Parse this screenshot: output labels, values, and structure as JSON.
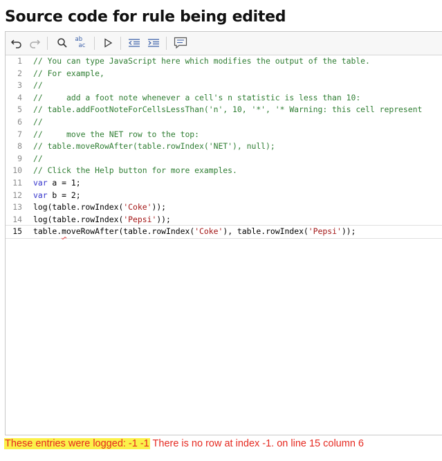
{
  "page": {
    "title": "Source code for rule being edited"
  },
  "toolbar": {
    "buttons": [
      {
        "name": "undo-button",
        "icon": "undo-icon"
      },
      {
        "name": "redo-button",
        "icon": "redo-icon"
      },
      {
        "name": "find-button",
        "icon": "search-icon"
      },
      {
        "name": "replace-button",
        "icon": "replace-icon",
        "label_top": "ab",
        "label_bottom": "ac"
      },
      {
        "name": "run-button",
        "icon": "play-icon"
      },
      {
        "name": "outdent-button",
        "icon": "outdent-icon"
      },
      {
        "name": "indent-button",
        "icon": "indent-icon"
      },
      {
        "name": "comment-button",
        "icon": "comment-icon"
      }
    ]
  },
  "editor": {
    "active_line": 15,
    "lines": [
      {
        "n": "1",
        "text": "// You can type JavaScript here which modifies the output of the table."
      },
      {
        "n": "2",
        "text": "// For example,"
      },
      {
        "n": "3",
        "text": "//"
      },
      {
        "n": "4",
        "text": "//     add a foot note whenever a cell's n statistic is less than 10:"
      },
      {
        "n": "5",
        "text": "// table.addFootNoteForCellsLessThan('n', 10, '*', '* Warning: this cell represent"
      },
      {
        "n": "6",
        "text": "//"
      },
      {
        "n": "7",
        "text": "//     move the NET row to the top:"
      },
      {
        "n": "8",
        "text": "// table.moveRowAfter(table.rowIndex('NET'), null);"
      },
      {
        "n": "9",
        "text": "//"
      },
      {
        "n": "10",
        "text": "// Click the Help button for more examples."
      },
      {
        "n": "11",
        "kw": "var",
        "rest": " a = 1;"
      },
      {
        "n": "12",
        "kw": "var",
        "rest": " b = 2;"
      },
      {
        "n": "13",
        "pre": "log(table.rowIndex(",
        "s1": "'Coke'",
        "post": "));"
      },
      {
        "n": "14",
        "pre": "log(table.rowIndex(",
        "s1": "'Pepsi'",
        "post": "));"
      },
      {
        "n": "15",
        "a": "table.",
        "err": "m",
        "b": "oveRowAfter(table.rowIndex(",
        "s1": "'Coke'",
        "c": "), table.rowIndex(",
        "s2": "'Pepsi'",
        "d": "));"
      }
    ]
  },
  "footer": {
    "logged_label": "These entries were logged: -1 -1",
    "error_message": " There is no row at index -1. on line 15 column 6"
  },
  "colors": {
    "comment": "#2e7d32",
    "keyword": "#3333cc",
    "string": "#a31515",
    "error": "#e5281f",
    "highlight": "#fbf14a"
  }
}
